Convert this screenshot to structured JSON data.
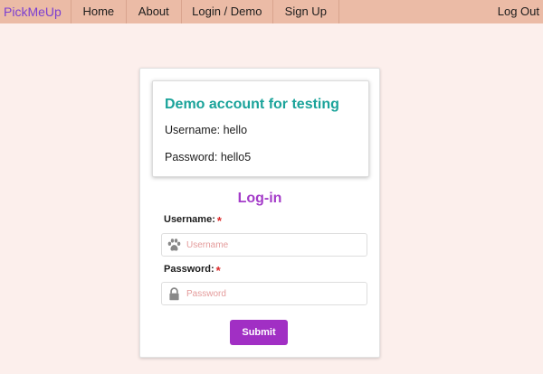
{
  "navbar": {
    "brand": "PickMeUp",
    "items": [
      {
        "label": "Home"
      },
      {
        "label": "About"
      },
      {
        "label": "Login / Demo"
      },
      {
        "label": "Sign Up"
      }
    ],
    "logout": "Log Out"
  },
  "demo": {
    "title": "Demo account for testing",
    "username_line": "Username: hello",
    "password_line": "Password: hello5"
  },
  "login": {
    "title": "Log-in",
    "username_label": "Username:",
    "username_placeholder": "Username",
    "password_label": "Password:",
    "password_placeholder": "Password",
    "required_mark": "*",
    "submit_label": "Submit"
  },
  "colors": {
    "page_bg": "#fcefec",
    "navbar_bg": "#ebbba6",
    "brand": "#7b3fd1",
    "demo_title": "#1aa39a",
    "login_title": "#a43cc9",
    "submit_bg": "#a12fc4",
    "required": "#db2828"
  },
  "icons": {
    "username_field": "paw-icon",
    "password_field": "lock-icon"
  }
}
